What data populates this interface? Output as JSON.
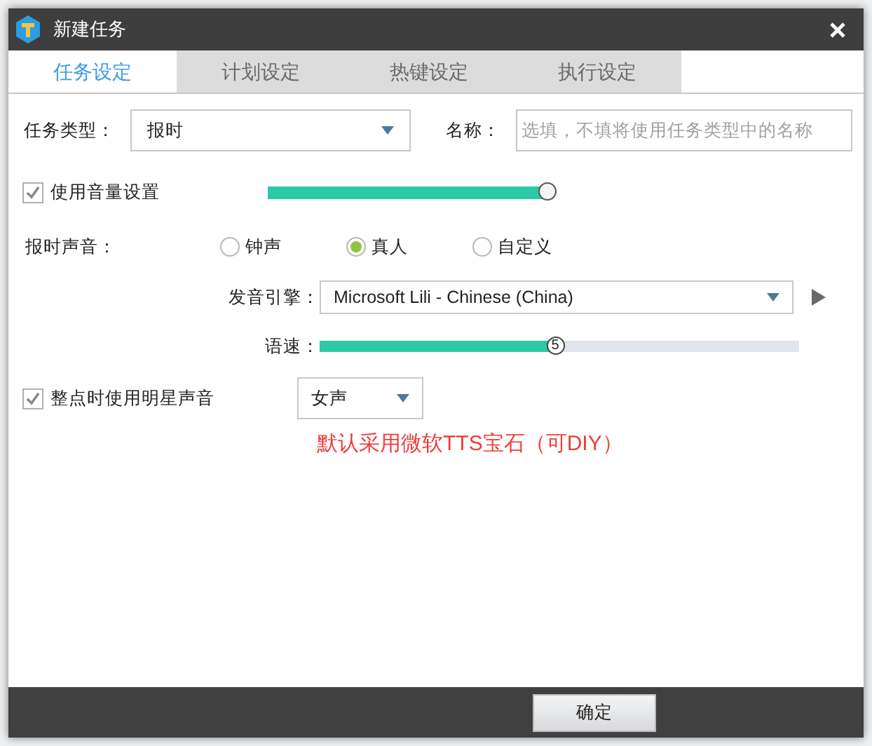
{
  "window": {
    "title": "新建任务"
  },
  "tabs": [
    {
      "label": "任务设定",
      "selected": true
    },
    {
      "label": "计划设定",
      "selected": false
    },
    {
      "label": "热键设定",
      "selected": false
    },
    {
      "label": "执行设定",
      "selected": false
    }
  ],
  "task_type": {
    "label": "任务类型：",
    "value": "报时"
  },
  "name": {
    "label": "名称：",
    "placeholder": "选填，不填将使用任务类型中的名称"
  },
  "volume": {
    "label": "使用音量设置",
    "checked": true,
    "level": 1
  },
  "sound": {
    "label": "报时声音：",
    "options": [
      {
        "label": "钟声",
        "selected": false
      },
      {
        "label": "真人",
        "selected": true
      },
      {
        "label": "自定义",
        "selected": false
      }
    ]
  },
  "engine": {
    "label": "发音引擎：",
    "value": "Microsoft Lili - Chinese (China)"
  },
  "speed": {
    "label": "语速：",
    "level": 0.49,
    "reading": "5"
  },
  "star_voice": {
    "label": "整点时使用明星声音",
    "checked": true,
    "value": "女声"
  },
  "note": "默认采用微软TTS宝石（可DIY）",
  "buttons": [
    "确定"
  ]
}
